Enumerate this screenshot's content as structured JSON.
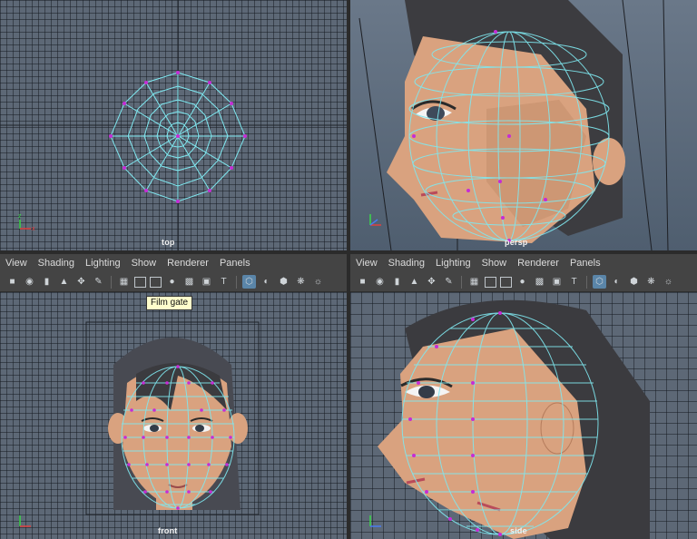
{
  "viewports": {
    "top": {
      "label": "top"
    },
    "persp": {
      "label": "persp"
    },
    "front": {
      "label": "front"
    },
    "side": {
      "label": "side"
    }
  },
  "panel_menu": [
    "View",
    "Shading",
    "Lighting",
    "Show",
    "Renderer",
    "Panels"
  ],
  "toolbar_icons": [
    "camera-icon",
    "camera-attr-icon",
    "bookmark-icon",
    "image-plane-icon",
    "2d-pan-icon",
    "grease-pencil-icon",
    "grid-icon",
    "film-gate-icon",
    "resolution-gate-icon",
    "gate-mask-icon",
    "field-chart-icon",
    "safe-action-icon",
    "safe-title-icon",
    "wireframe-icon",
    "smooth-shade-icon",
    "textured-icon",
    "lights-icon",
    "shadows-icon"
  ],
  "tooltip": {
    "text": "Film gate"
  },
  "colors": {
    "wire": "#7fe8f0",
    "vertex": "#c62cd6",
    "skin": "#d9a27f",
    "hair": "#3b3b3f",
    "bg": "#5d6876"
  }
}
